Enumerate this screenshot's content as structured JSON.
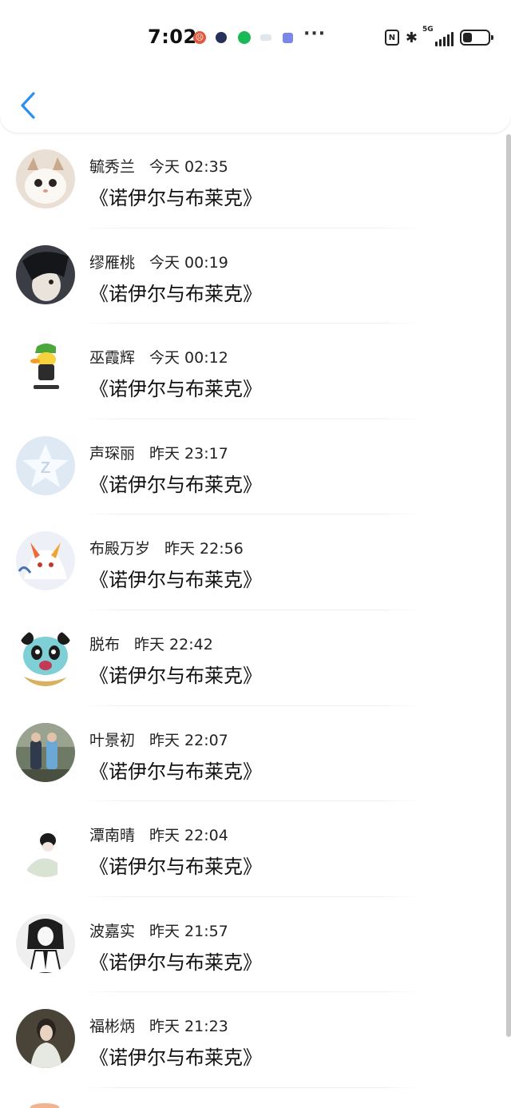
{
  "status_bar": {
    "time": "7:02",
    "network": "5G",
    "battery_level": 0.35
  },
  "header": {
    "back_icon": "chevron-left-icon",
    "accent_color": "#2d8df6"
  },
  "list": {
    "items": [
      {
        "name": "毓秀兰",
        "time": "今天 02:35",
        "message": "《诺伊尔与布莱克》",
        "avatar": "cat-avatar"
      },
      {
        "name": "缪雁桃",
        "time": "今天 00:19",
        "message": "《诺伊尔与布莱克》",
        "avatar": "anime-boy-avatar"
      },
      {
        "name": "巫霞辉",
        "time": "今天 00:12",
        "message": "《诺伊尔与布莱克》",
        "avatar": "duck-avatar"
      },
      {
        "name": "声琛丽",
        "time": "昨天 23:17",
        "message": "《诺伊尔与布莱克》",
        "avatar": "qq-default-avatar"
      },
      {
        "name": "布殿万岁",
        "time": "昨天 22:56",
        "message": "《诺伊尔与布莱克》",
        "avatar": "fox-avatar"
      },
      {
        "name": "脱布",
        "time": "昨天 22:42",
        "message": "《诺伊尔与布莱克》",
        "avatar": "panda-avatar"
      },
      {
        "name": "叶景初",
        "time": "昨天 22:07",
        "message": "《诺伊尔与布莱克》",
        "avatar": "couple-photo-avatar"
      },
      {
        "name": "潭南晴",
        "time": "昨天 22:04",
        "message": "《诺伊尔与布莱克》",
        "avatar": "sketch-boy-avatar"
      },
      {
        "name": "波嘉实",
        "time": "昨天 21:57",
        "message": "《诺伊尔与布莱克》",
        "avatar": "bw-girl-avatar"
      },
      {
        "name": "福彬炳",
        "time": "昨天 21:23",
        "message": "《诺伊尔与布莱克》",
        "avatar": "woman-photo-avatar"
      }
    ]
  }
}
